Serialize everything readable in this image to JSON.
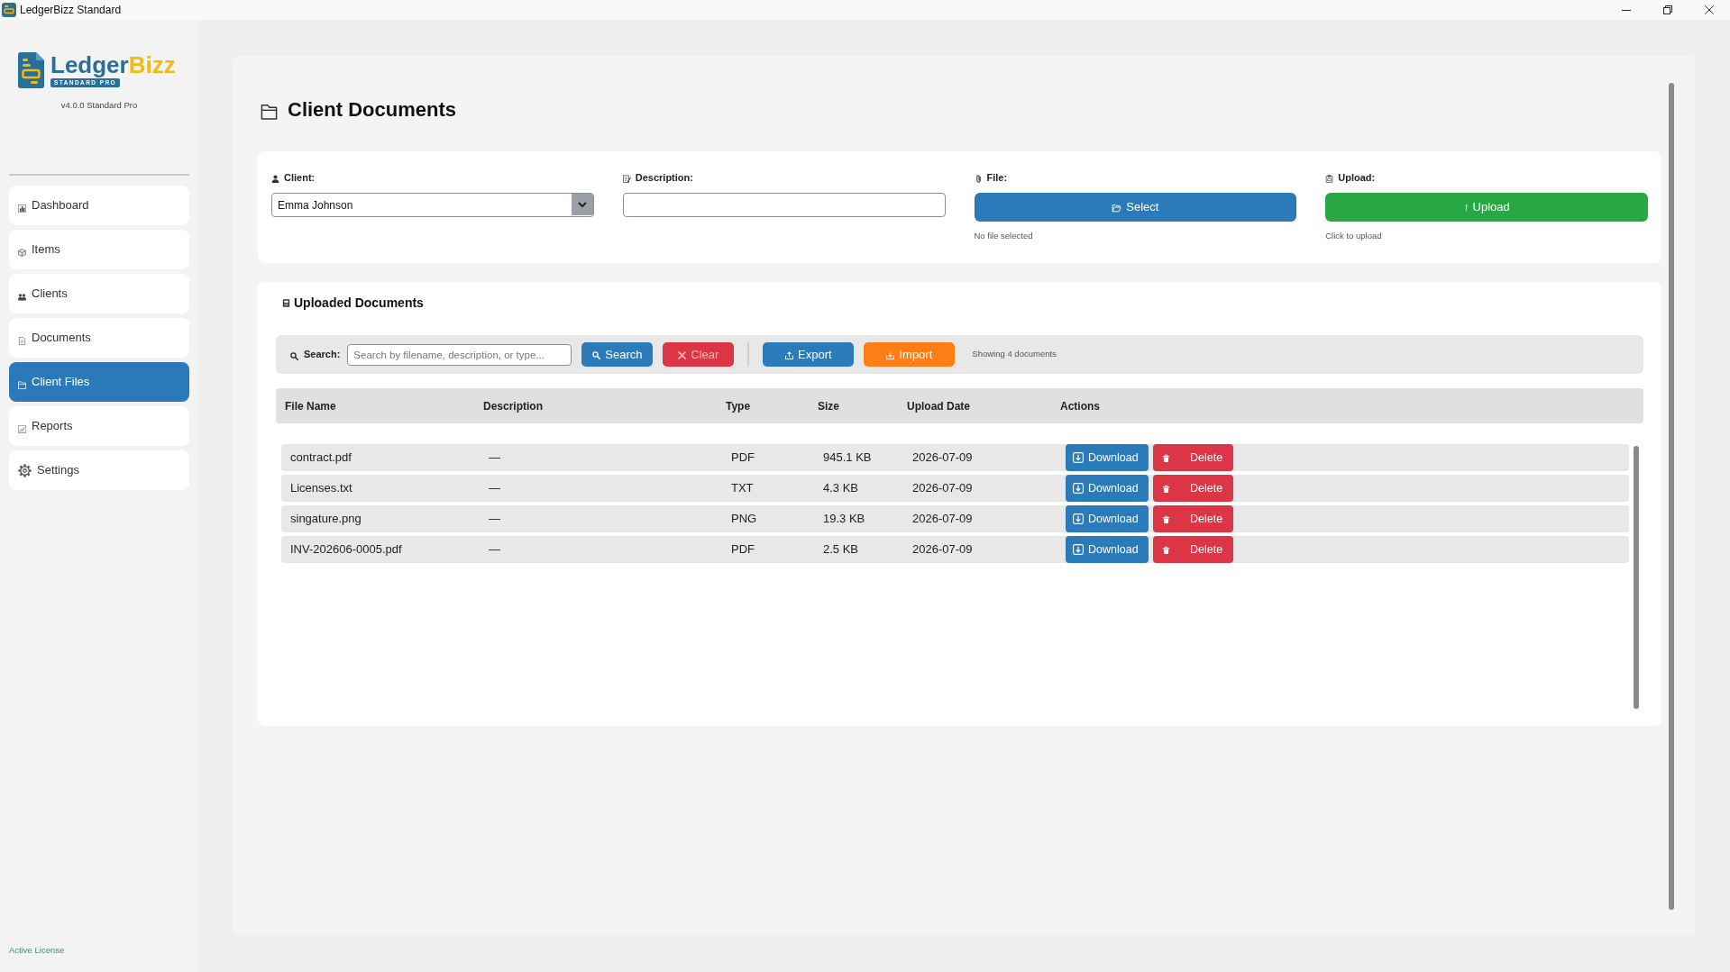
{
  "window": {
    "title": "LedgerBizz Standard"
  },
  "sidebar": {
    "logo": {
      "first": "Ledger",
      "second": "Bizz",
      "badge": "STANDARD PRO"
    },
    "version": "v4.0.0 Standard Pro",
    "items": [
      {
        "label": "Dashboard",
        "selected": false
      },
      {
        "label": "Items",
        "selected": false
      },
      {
        "label": "Clients",
        "selected": false
      },
      {
        "label": "Documents",
        "selected": false
      },
      {
        "label": "Client Files",
        "selected": true
      },
      {
        "label": "Reports",
        "selected": false
      },
      {
        "label": "Settings",
        "selected": false
      }
    ],
    "license": "Active License"
  },
  "page": {
    "title": "Client Documents"
  },
  "upload_form": {
    "fields": [
      {
        "kind": "select",
        "label": "Client:",
        "value": "Emma Johnson"
      },
      {
        "kind": "text",
        "label": "Description:"
      },
      {
        "kind": "file",
        "label": "File:",
        "button": "Select",
        "hint": "No file selected"
      },
      {
        "kind": "upload",
        "label": "Upload:",
        "button": "↑ Upload",
        "hint": "Click to upload"
      }
    ]
  },
  "documents": {
    "title": "Uploaded Documents",
    "search": {
      "label": "Search:",
      "placeholder": "Search by filename, description, or type..."
    },
    "button_groups": [
      [
        {
          "label": "Search",
          "kind": "search",
          "disabled": false
        },
        {
          "label": "Clear",
          "kind": "clear",
          "disabled": true
        }
      ],
      [
        {
          "label": "Export",
          "kind": "export",
          "disabled": false
        },
        {
          "label": "Import",
          "kind": "import",
          "disabled": false
        }
      ]
    ],
    "count": "Showing 4 documents",
    "table": {
      "columns": [
        "File Name",
        "Description",
        "Type",
        "Size",
        "Upload Date",
        "Actions"
      ],
      "rows": [
        {
          "cells": [
            "contract.pdf",
            "—",
            "PDF",
            "945.1 KB",
            "2026-07-09"
          ],
          "actions": [
            {
              "label": "Download",
              "kind": "download"
            },
            {
              "label": "Delete",
              "kind": "delete"
            }
          ]
        },
        {
          "cells": [
            "Licenses.txt",
            "—",
            "TXT",
            "4.3 KB",
            "2026-07-09"
          ],
          "actions": [
            {
              "label": "Download",
              "kind": "download"
            },
            {
              "label": "Delete",
              "kind": "delete"
            }
          ]
        },
        {
          "cells": [
            "singature.png",
            "—",
            "PNG",
            "19.3 KB",
            "2026-07-09"
          ],
          "actions": [
            {
              "label": "Download",
              "kind": "download"
            },
            {
              "label": "Delete",
              "kind": "delete"
            }
          ]
        },
        {
          "cells": [
            "INV-202606-0005.pdf",
            "—",
            "PDF",
            "2.5 KB",
            "2026-07-09"
          ],
          "actions": [
            {
              "label": "Download",
              "kind": "download"
            },
            {
              "label": "Delete",
              "kind": "delete"
            }
          ]
        }
      ]
    }
  }
}
